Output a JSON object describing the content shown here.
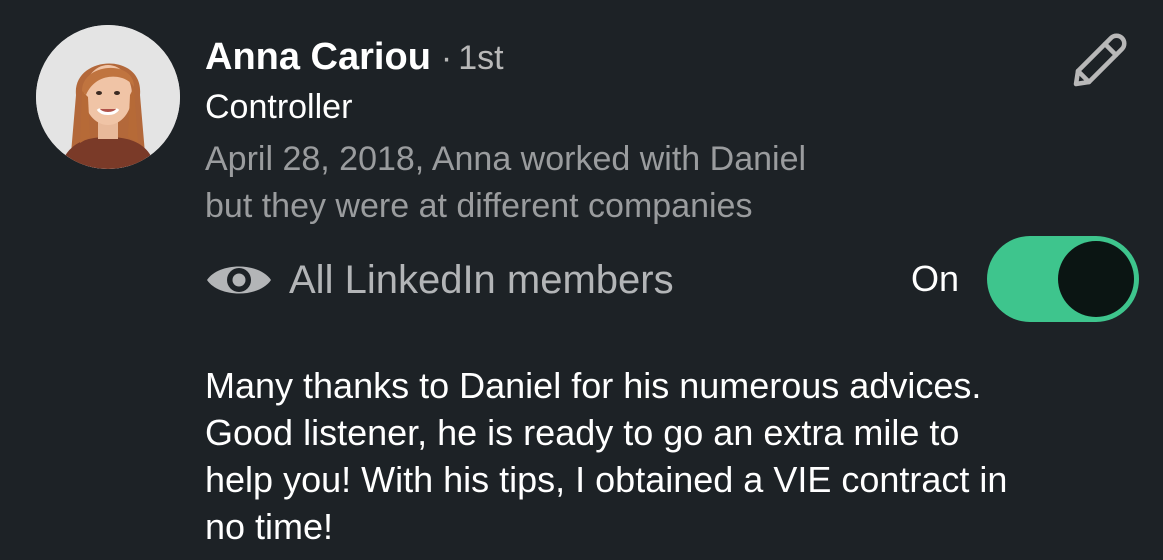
{
  "recommendation": {
    "name": "Anna Cariou",
    "separator": "·",
    "degree": "1st",
    "headline": "Controller",
    "relationship_lines": [
      "April 28, 2018, Anna worked with Daniel",
      "but they were at different companies"
    ],
    "visibility": {
      "icon": "eye-icon",
      "label": "All LinkedIn members"
    },
    "toggle": {
      "label": "On",
      "state": "on",
      "color": "#3ec58d"
    },
    "text_lines": [
      "Many thanks to Daniel for his numerous advices.",
      "Good listener, he is ready to go an extra mile to",
      "help you! With his tips, I obtained a VIE contract in",
      "no time!"
    ],
    "edit_icon": "pencil-icon"
  }
}
